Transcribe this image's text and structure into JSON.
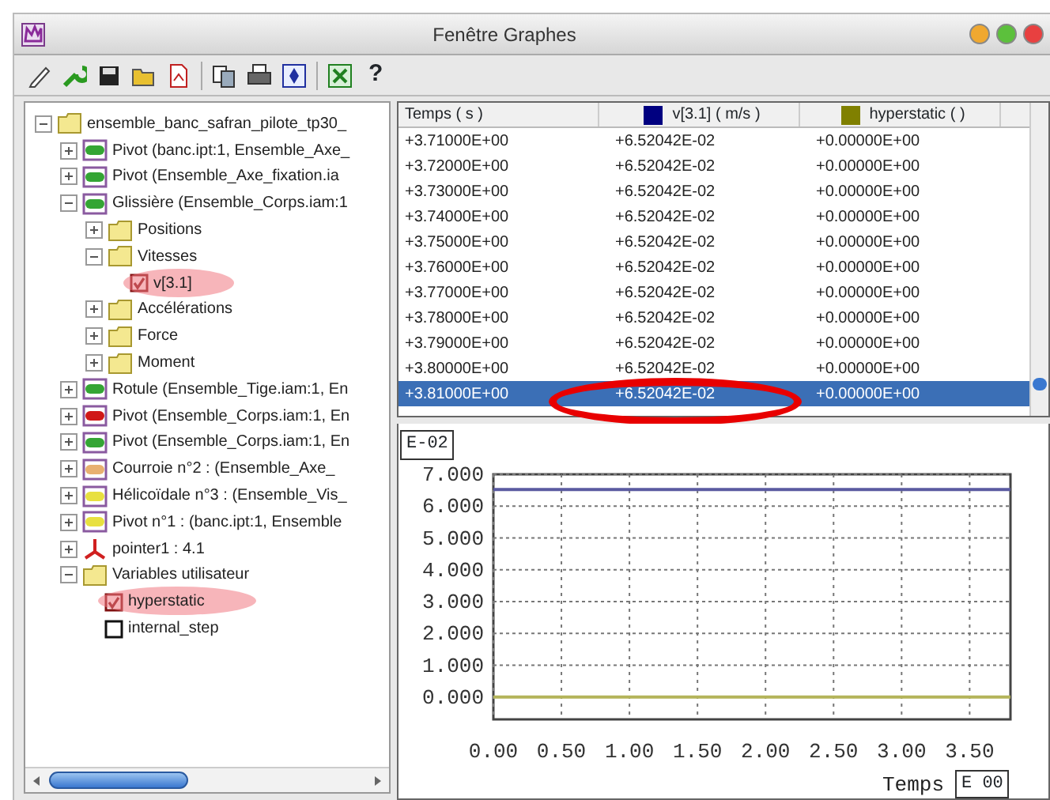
{
  "window": {
    "title": "Fenêtre Graphes"
  },
  "toolbar": {
    "help": "?"
  },
  "tree": {
    "label": "ensemble_banc_safran_pilote_tp30_",
    "kind": "folder",
    "expanded": true,
    "children": [
      {
        "label": "Pivot (banc.ipt:1, Ensemble_Axe_",
        "kind": "joint",
        "color": "#34a534",
        "expanded": false
      },
      {
        "label": "Pivot (Ensemble_Axe_fixation.ia",
        "kind": "joint",
        "color": "#34a534",
        "expanded": false
      },
      {
        "label": "Glissière (Ensemble_Corps.iam:1",
        "kind": "joint",
        "color": "#34a534",
        "expanded": true,
        "children": [
          {
            "label": "Positions",
            "kind": "folder",
            "expanded": false
          },
          {
            "label": "Vitesses",
            "kind": "folder",
            "expanded": true,
            "children": [
              {
                "label": "v[3.1]",
                "kind": "variable",
                "checked": true,
                "highlighted": true
              }
            ]
          },
          {
            "label": "Accélérations",
            "kind": "folder",
            "expanded": false
          },
          {
            "label": "Force",
            "kind": "folder",
            "expanded": false
          },
          {
            "label": "Moment",
            "kind": "folder",
            "expanded": false
          }
        ]
      },
      {
        "label": "Rotule (Ensemble_Tige.iam:1, En",
        "kind": "joint",
        "color": "#34a534",
        "expanded": false
      },
      {
        "label": "Pivot (Ensemble_Corps.iam:1, En",
        "kind": "joint",
        "color": "#d01818",
        "expanded": false
      },
      {
        "label": "Pivot (Ensemble_Corps.iam:1, En",
        "kind": "joint",
        "color": "#34a534",
        "expanded": false
      },
      {
        "label": "Courroie n°2 :  (Ensemble_Axe_",
        "kind": "joint",
        "color": "#e8b070",
        "expanded": false
      },
      {
        "label": "Hélicoïdale n°3 :  (Ensemble_Vis_",
        "kind": "joint",
        "color": "#e8e040",
        "expanded": false
      },
      {
        "label": "Pivot n°1 :  (banc.ipt:1, Ensemble",
        "kind": "joint",
        "color": "#e8e040",
        "expanded": false
      },
      {
        "label": "pointer1 : 4.1",
        "kind": "pointer",
        "expanded": false
      },
      {
        "label": "Variables utilisateur",
        "kind": "folder",
        "expanded": true,
        "children": [
          {
            "label": "hyperstatic",
            "kind": "variable",
            "checked": true,
            "highlighted": true
          },
          {
            "label": "internal_step",
            "kind": "variable",
            "checked": false,
            "highlighted": false
          }
        ]
      }
    ]
  },
  "table": {
    "columns": [
      {
        "label": "Temps ( s )"
      },
      {
        "label": "v[3.1] ( m/s )",
        "color": "#000080"
      },
      {
        "label": "hyperstatic ( )",
        "color": "#808000"
      }
    ],
    "rows": [
      {
        "cells": [
          "+3.71000E+00",
          "+6.52042E-02",
          "+0.00000E+00"
        ],
        "selected": false
      },
      {
        "cells": [
          "+3.72000E+00",
          "+6.52042E-02",
          "+0.00000E+00"
        ],
        "selected": false
      },
      {
        "cells": [
          "+3.73000E+00",
          "+6.52042E-02",
          "+0.00000E+00"
        ],
        "selected": false
      },
      {
        "cells": [
          "+3.74000E+00",
          "+6.52042E-02",
          "+0.00000E+00"
        ],
        "selected": false
      },
      {
        "cells": [
          "+3.75000E+00",
          "+6.52042E-02",
          "+0.00000E+00"
        ],
        "selected": false
      },
      {
        "cells": [
          "+3.76000E+00",
          "+6.52042E-02",
          "+0.00000E+00"
        ],
        "selected": false
      },
      {
        "cells": [
          "+3.77000E+00",
          "+6.52042E-02",
          "+0.00000E+00"
        ],
        "selected": false
      },
      {
        "cells": [
          "+3.78000E+00",
          "+6.52042E-02",
          "+0.00000E+00"
        ],
        "selected": false
      },
      {
        "cells": [
          "+3.79000E+00",
          "+6.52042E-02",
          "+0.00000E+00"
        ],
        "selected": false
      },
      {
        "cells": [
          "+3.80000E+00",
          "+6.52042E-02",
          "+0.00000E+00"
        ],
        "selected": false
      },
      {
        "cells": [
          "+3.81000E+00",
          "+6.52042E-02",
          "+0.00000E+00"
        ],
        "selected": true,
        "circled": [
          false,
          true,
          false
        ]
      }
    ]
  },
  "graph": {
    "y_scale": "E-02",
    "x_scale": "E 00",
    "chart_data": {
      "type": "line",
      "xlabel": "Temps",
      "x": [
        0,
        3.8
      ],
      "grid": true,
      "series": [
        {
          "color": "#5a5aa0",
          "values": [
            6.52,
            6.52
          ]
        },
        {
          "color": "#b4b45a",
          "values": [
            0,
            0
          ]
        }
      ],
      "xlim": [
        0,
        3.8
      ],
      "ylim": [
        -0.7,
        7
      ],
      "xticks": [
        {
          "value": 0,
          "label": "0.00"
        },
        {
          "value": 0.5,
          "label": "0.50"
        },
        {
          "value": 1,
          "label": "1.00"
        },
        {
          "value": 1.5,
          "label": "1.50"
        },
        {
          "value": 2,
          "label": "2.00"
        },
        {
          "value": 2.5,
          "label": "2.50"
        },
        {
          "value": 3,
          "label": "3.00"
        },
        {
          "value": 3.5,
          "label": "3.50"
        }
      ],
      "yticks": [
        {
          "value": 0,
          "label": "0.000"
        },
        {
          "value": 1,
          "label": "1.000"
        },
        {
          "value": 2,
          "label": "2.000"
        },
        {
          "value": 3,
          "label": "3.000"
        },
        {
          "value": 4,
          "label": "4.000"
        },
        {
          "value": 5,
          "label": "5.000"
        },
        {
          "value": 6,
          "label": "6.000"
        },
        {
          "value": 7,
          "label": "7.000"
        }
      ]
    }
  }
}
